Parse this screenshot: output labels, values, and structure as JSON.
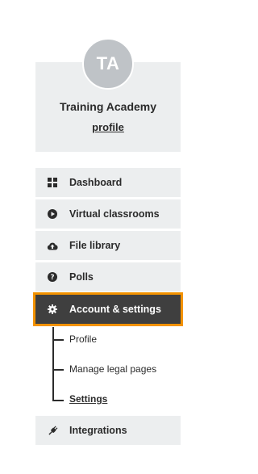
{
  "profile": {
    "initials": "TA",
    "name": "Training Academy",
    "link_label": "profile"
  },
  "menu": {
    "items": [
      {
        "label": "Dashboard",
        "icon": "grid-icon"
      },
      {
        "label": "Virtual classrooms",
        "icon": "play-circle-icon"
      },
      {
        "label": "File library",
        "icon": "cloud-upload-icon"
      },
      {
        "label": "Polls",
        "icon": "question-circle-icon"
      },
      {
        "label": "Account & settings",
        "icon": "gear-icon",
        "active": true
      },
      {
        "label": "Integrations",
        "icon": "plug-icon"
      }
    ],
    "submenu": [
      {
        "label": "Profile"
      },
      {
        "label": "Manage legal pages"
      },
      {
        "label": "Settings",
        "current": true
      }
    ]
  },
  "colors": {
    "accent": "#f39200",
    "active_bg": "#3f3f3f",
    "item_bg": "#eceeef",
    "avatar_bg": "#bfc3c7"
  }
}
